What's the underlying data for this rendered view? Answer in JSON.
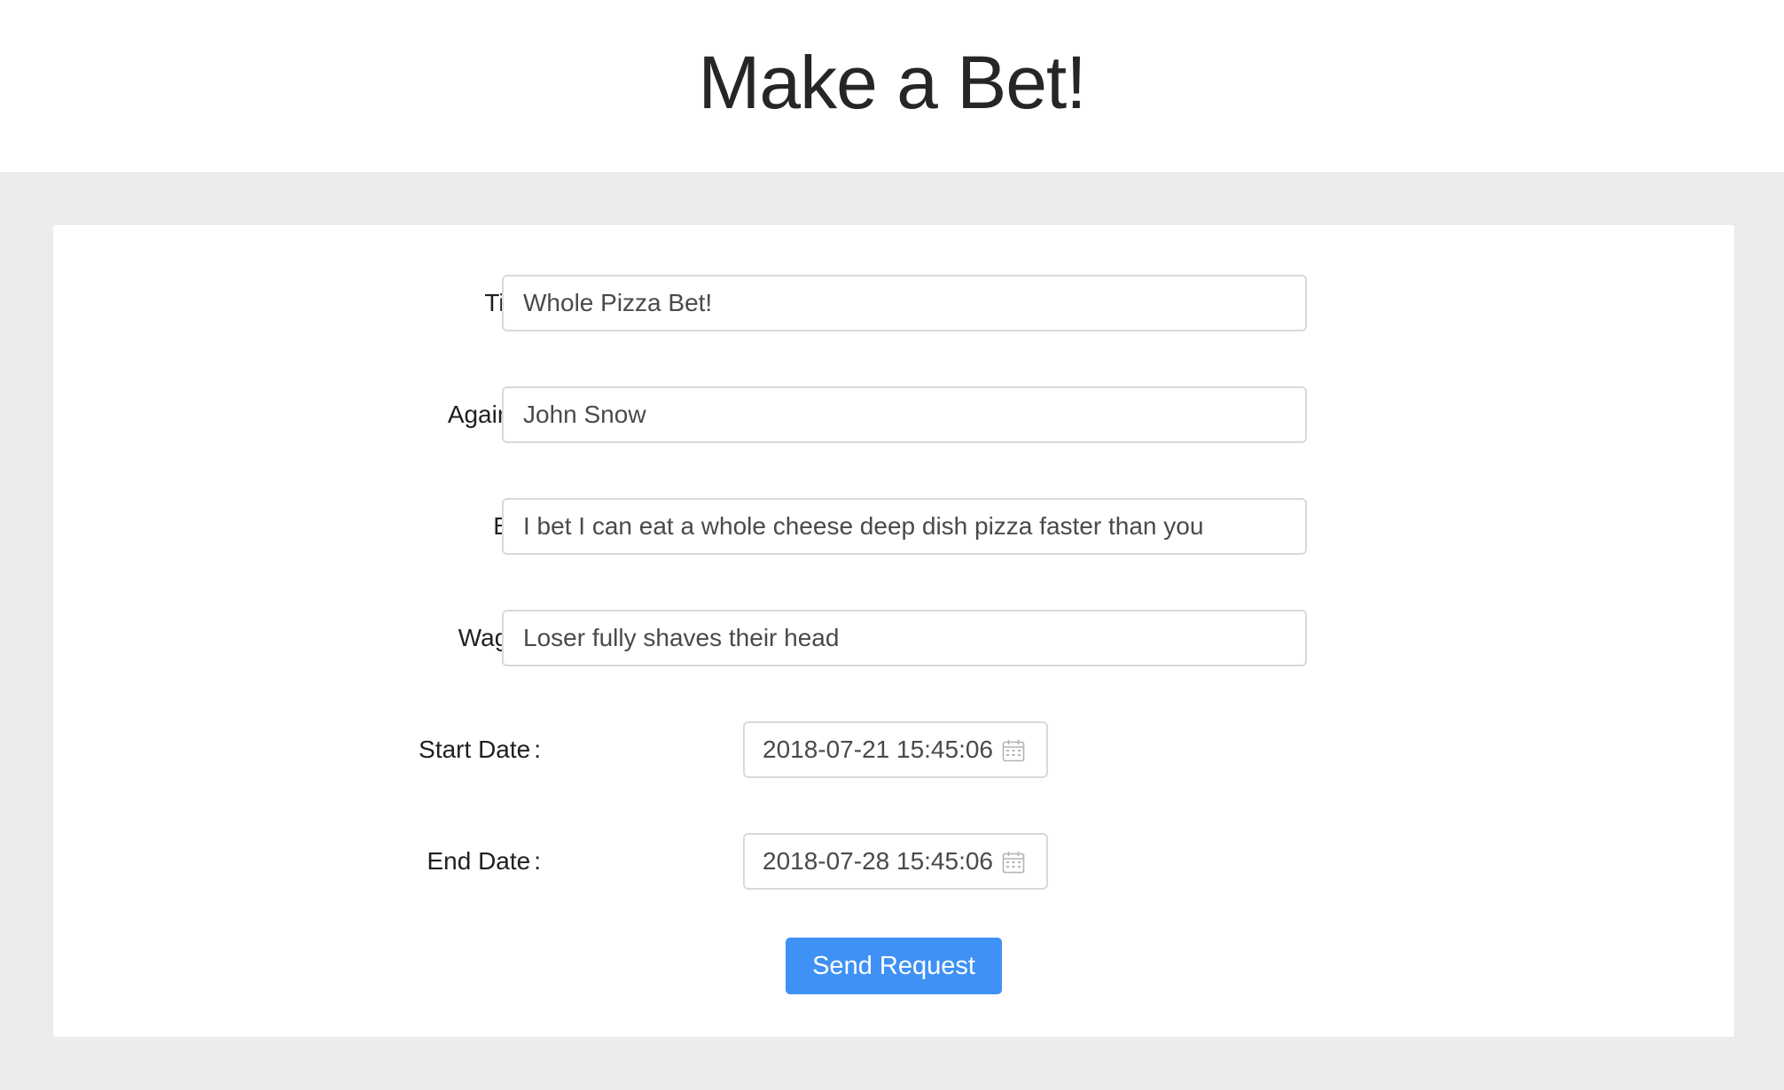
{
  "page": {
    "title": "Make a Bet!"
  },
  "form": {
    "fields": [
      {
        "label": "Title",
        "value": "Whole Pizza Bet!"
      },
      {
        "label": "Against",
        "value": "John Snow"
      },
      {
        "label": "Bet",
        "value": "I bet I can eat a whole cheese deep dish pizza faster than you"
      },
      {
        "label": "Wager",
        "value": "Loser fully shaves their head"
      }
    ],
    "start_date": {
      "label": "Start Date",
      "value": "2018-07-21 15:45:06"
    },
    "end_date": {
      "label": "End Date",
      "value": "2018-07-28 15:45:06"
    },
    "colon": ":",
    "submit_label": "Send Request"
  },
  "icons": {
    "date_picker": "calendar-icon"
  },
  "colors": {
    "accent": "#3f91f5",
    "background": "#ececec",
    "card": "#ffffff"
  }
}
